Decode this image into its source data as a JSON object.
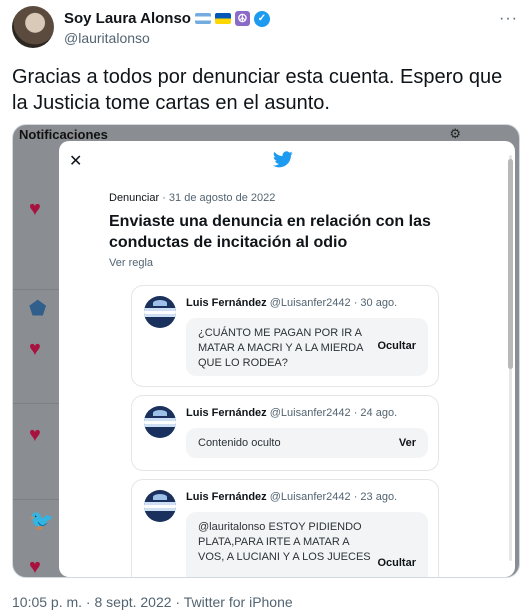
{
  "tweet": {
    "author_name": "Soy Laura Alonso",
    "author_handle": "@lauritalonso",
    "badges": {
      "flag1": "argentina-flag",
      "flag2": "ukraine-flag",
      "peace": "☮",
      "verified": "✓"
    },
    "text": "Gracias a todos por denunciar esta cuenta. Espero que la Justicia tome cartas en el asunto.",
    "more": "···",
    "timestamp": "10:05 p. m. · 8 sept. 2022 · Twitter for iPhone"
  },
  "media": {
    "background_title": "Notificaciones",
    "background_icons": [
      "heart-icon",
      "shield-icon",
      "heart-icon",
      "heart-icon",
      "bird-icon",
      "heart-icon"
    ],
    "modal": {
      "close": "✕",
      "meta_label": "Denunciar",
      "meta_date": " · 31 de agosto de 2022",
      "title": "Enviaste una denuncia en relación con las conductas de incitación al odio",
      "link": "Ver regla",
      "reports": [
        {
          "name": "Luis Fernández",
          "handle": "@Luisanfer2442",
          "date": "· 30 ago.",
          "text": "¿CUÁNTO ME PAGAN POR IR A MATAR A MACRI Y A LA MIERDA QUE LO RODEA?",
          "action": "Ocultar"
        },
        {
          "name": "Luis Fernández",
          "handle": "@Luisanfer2442",
          "date": "· 24 ago.",
          "text": "Contenido oculto",
          "action": "Ver"
        },
        {
          "name": "Luis Fernández",
          "handle": "@Luisanfer2442",
          "date": "· 23 ago.",
          "text": "@lauritalonso ESTOY PIDIENDO PLATA,PARA IRTE  A MATAR A VOS, A LUCIANI Y A LOS JUECES",
          "action": "Ocultar"
        }
      ]
    }
  },
  "colors": {
    "accent": "#1d9bf0",
    "heart": "#a8123f",
    "text": "#0f1419",
    "muted": "#536471"
  }
}
